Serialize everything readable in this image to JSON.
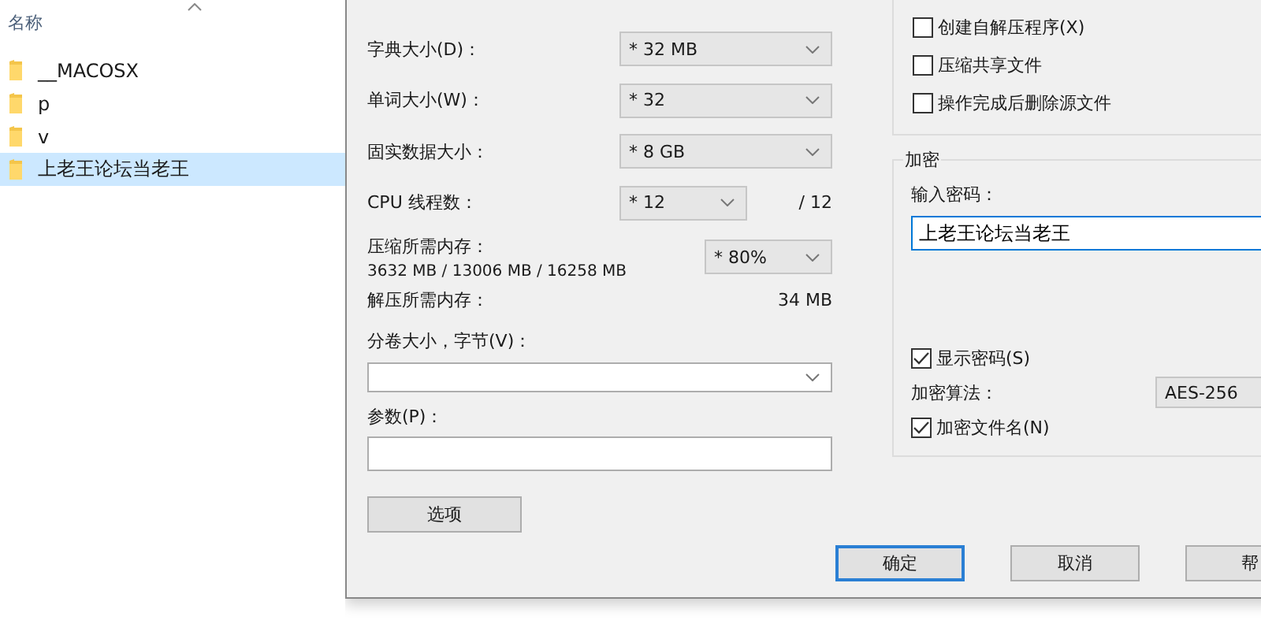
{
  "file_list": {
    "column_header": "名称",
    "items": [
      {
        "name": "__MACOSX",
        "selected": false
      },
      {
        "name": "p",
        "selected": false
      },
      {
        "name": "v",
        "selected": false
      },
      {
        "name": "上老王论坛当老王",
        "selected": true
      }
    ]
  },
  "dialog": {
    "settings": [
      {
        "kind": "combo",
        "label": "字典大小(D)：",
        "value": "* 32 MB"
      },
      {
        "kind": "combo",
        "label": "单词大小(W)：",
        "value": "* 32"
      },
      {
        "kind": "combo",
        "label": "固实数据大小：",
        "value": "* 8 GB"
      },
      {
        "kind": "threads",
        "label": "CPU 线程数：",
        "value": "* 12",
        "note": "/ 12"
      },
      {
        "kind": "memory",
        "label": "压缩所需内存：",
        "detail": "3632 MB / 13006 MB / 16258 MB",
        "value": "* 80%"
      },
      {
        "kind": "info",
        "label": "解压所需内存：",
        "note": "34 MB"
      }
    ],
    "volume": {
      "label": "分卷大小，字节(V)："
    },
    "parameters": {
      "label": "参数(P)："
    },
    "options_button": "选项",
    "options": [
      {
        "label": "创建自解压程序(X)",
        "checked": false
      },
      {
        "label": "压缩共享文件",
        "checked": false
      },
      {
        "label": "操作完成后删除源文件",
        "checked": false
      }
    ],
    "encryption": {
      "title": "加密",
      "password_label": "输入密码：",
      "password": "上老王论坛当老王",
      "show_password": {
        "label": "显示密码(S)",
        "checked": true
      },
      "method_label": "加密算法：",
      "method": "AES-256",
      "encrypt_names": {
        "label": "加密文件名(N)",
        "checked": true
      }
    },
    "buttons": [
      {
        "label": "确定",
        "default": true
      },
      {
        "label": "取消",
        "default": false
      },
      {
        "label": "帮",
        "default": false
      }
    ]
  }
}
